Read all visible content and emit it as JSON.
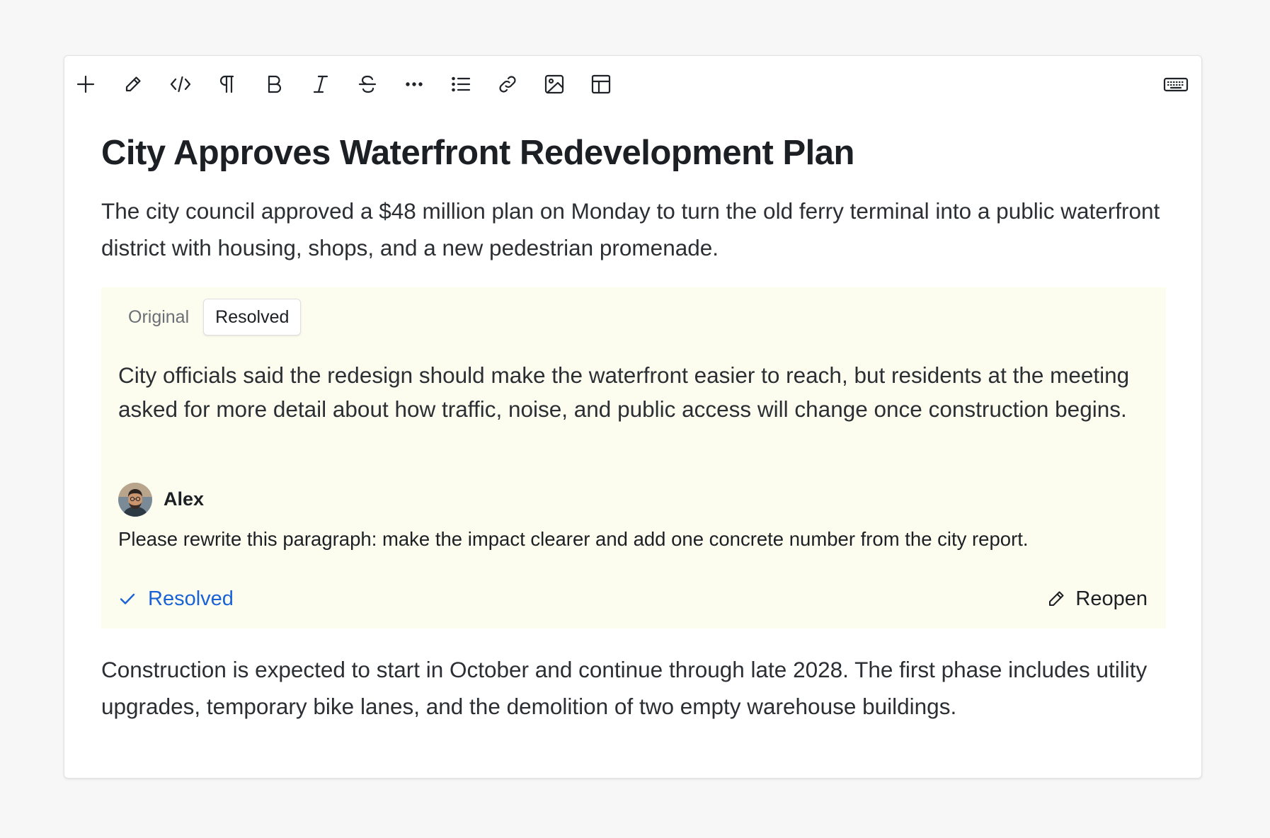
{
  "toolbar": {
    "tools": [
      {
        "name": "plus-icon"
      },
      {
        "name": "pencil-icon"
      },
      {
        "name": "code-icon"
      },
      {
        "name": "pilcrow-icon"
      },
      {
        "name": "bold-icon",
        "glyph": "B"
      },
      {
        "name": "italic-icon",
        "glyph": "I"
      },
      {
        "name": "strikethrough-icon",
        "glyph": "S"
      },
      {
        "name": "more-icon"
      },
      {
        "name": "bullet-list-icon"
      },
      {
        "name": "link-icon"
      },
      {
        "name": "image-icon"
      },
      {
        "name": "table-icon"
      },
      {
        "name": "keyboard-icon"
      }
    ]
  },
  "document": {
    "title": "City Approves Waterfront Redevelopment Plan",
    "paragraph_1": "The city council approved a $48 million plan on Monday to turn the old ferry terminal into a public waterfront district with housing, shops, and a new pedestrian promenade.",
    "paragraph_2": "Construction is expected to start in October and continue through late 2028. The first phase includes utility upgrades, temporary bike lanes, and the demolition of two empty warehouse buildings."
  },
  "comment": {
    "tabs": [
      "Original",
      "Resolved"
    ],
    "active_tab": "Resolved",
    "text": "City officials said the redesign should make the waterfront easier to reach, but residents at the meeting asked for more detail about how traffic, noise, and public access will change once construction begins.",
    "author": "Alex",
    "body": "Please rewrite this paragraph: make the impact clearer and add one concrete number from the city report.",
    "status_label": "Resolved",
    "reopen_label": "Reopen"
  },
  "colors": {
    "comment_background": "#fcfdee",
    "resolved_blue": "#1a63d6"
  }
}
